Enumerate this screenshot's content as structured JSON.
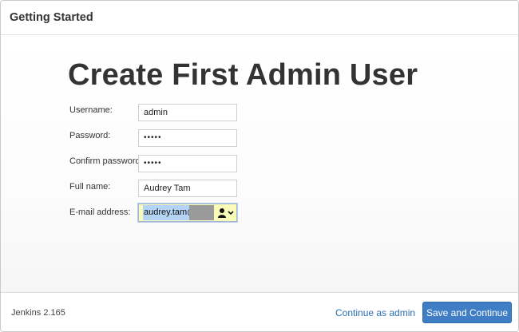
{
  "header": {
    "title": "Getting Started"
  },
  "main": {
    "heading": "Create First Admin User",
    "fields": {
      "username": {
        "label": "Username:",
        "value": "admin"
      },
      "password": {
        "label": "Password:",
        "value": "•••••"
      },
      "confirm_password": {
        "label": "Confirm password:",
        "value": "•••••"
      },
      "full_name": {
        "label": "Full name:",
        "value": "Audrey Tam"
      },
      "email": {
        "label": "E-mail address:",
        "value": "audrey.tam@"
      }
    }
  },
  "footer": {
    "version": "Jenkins 2.165",
    "continue_as_admin": "Continue as admin",
    "save_and_continue": "Save and Continue"
  },
  "colors": {
    "primary_button": "#3f7dc5",
    "link": "#2d6fb3",
    "autofill_background": "#fafab9"
  },
  "icons": {
    "email_autofill": "person-icon",
    "email_dropdown": "chevron-down-icon"
  }
}
